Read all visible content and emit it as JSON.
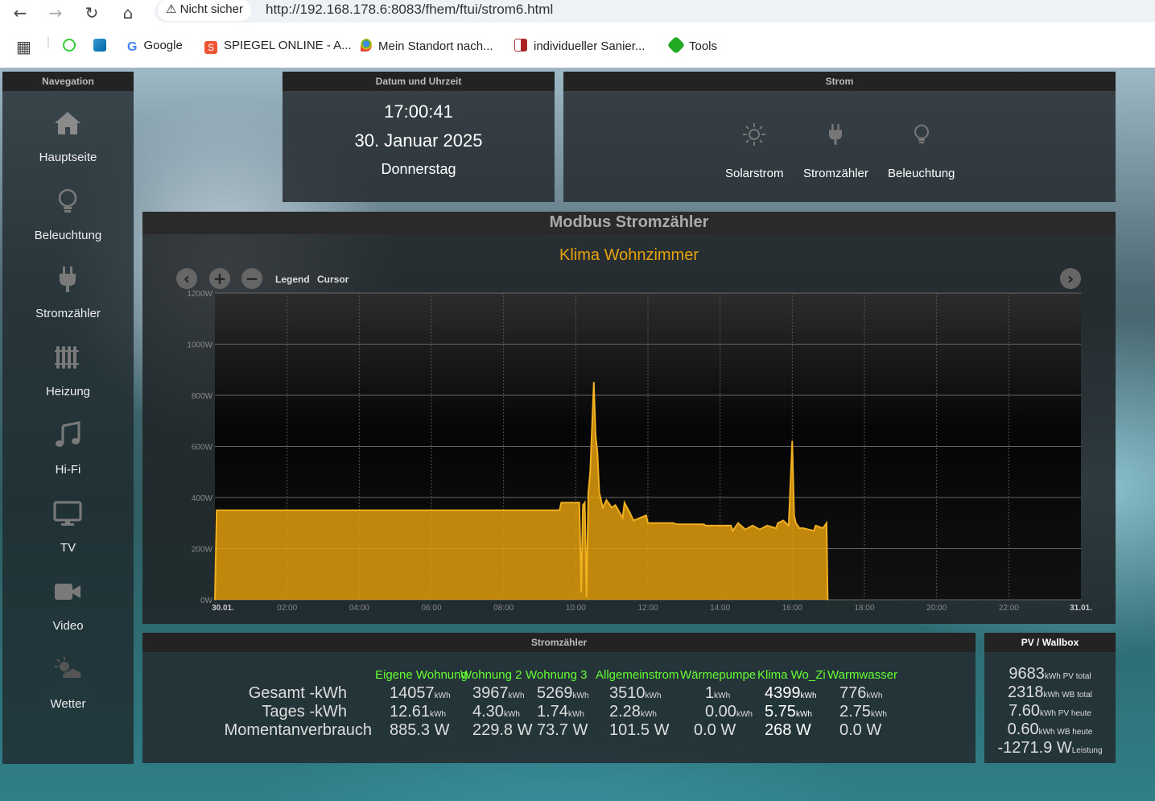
{
  "browser": {
    "security_label": "Nicht sicher",
    "url": "http://192.168.178.6:8083/fhem/ftui/strom6.html",
    "bookmarks": [
      "Google",
      "SPIEGEL ONLINE - A...",
      "Mein Standort nach...",
      "individueller Sanier...",
      "Tools"
    ]
  },
  "sidebar": {
    "title": "Navegation",
    "items": [
      {
        "label": "Hauptseite",
        "icon": "home-icon"
      },
      {
        "label": "Beleuchtung",
        "icon": "lightbulb-icon"
      },
      {
        "label": "Stromzähler",
        "icon": "plug-icon"
      },
      {
        "label": "Heizung",
        "icon": "radiator-icon"
      },
      {
        "label": "Hi-Fi",
        "icon": "music-icon"
      },
      {
        "label": "TV",
        "icon": "monitor-icon"
      },
      {
        "label": "Video",
        "icon": "video-camera-icon"
      },
      {
        "label": "Wetter",
        "icon": "weather-icon"
      }
    ]
  },
  "datetime": {
    "title": "Datum und Uhrzeit",
    "time": "17:00:41",
    "date": "30. Januar 2025",
    "weekday": "Donnerstag"
  },
  "strom": {
    "title": "Strom",
    "items": [
      {
        "label": "Solarstrom",
        "icon": "sun-icon"
      },
      {
        "label": "Stromzähler",
        "icon": "plug-icon"
      },
      {
        "label": "Beleuchtung",
        "icon": "lightbulb-icon"
      }
    ]
  },
  "chart": {
    "title": "Modbus Stromzähler",
    "subtitle": "Klima Wohnzimmer",
    "controls": {
      "legend": "Legend",
      "cursor": "Cursor"
    }
  },
  "chart_data": {
    "type": "area",
    "title": "Klima Wohnzimmer",
    "xlabel": "",
    "ylabel": "",
    "color": "#e8a20c",
    "ylim": [
      0,
      1200
    ],
    "yticks": [
      "0W",
      "200W",
      "400W",
      "600W",
      "800W",
      "1000W",
      "1200W"
    ],
    "xticks": [
      "30.01.",
      "02:00",
      "04:00",
      "06:00",
      "08:00",
      "10:00",
      "12:00",
      "14:00",
      "16:00",
      "18:00",
      "20:00",
      "22:00",
      "31.01."
    ],
    "xlim": [
      0,
      24
    ],
    "x": [
      0,
      0.05,
      9.55,
      9.6,
      10.1,
      10.15,
      10.2,
      10.25,
      10.3,
      10.35,
      10.4,
      10.5,
      10.55,
      10.6,
      10.65,
      10.75,
      10.85,
      11.0,
      11.1,
      11.3,
      11.35,
      11.5,
      11.6,
      11.95,
      12.0,
      12.7,
      12.8,
      13.55,
      13.6,
      14.3,
      14.35,
      14.5,
      14.7,
      14.9,
      15.1,
      15.3,
      15.55,
      15.6,
      15.75,
      15.9,
      16.0,
      16.05,
      16.1,
      16.2,
      16.3,
      16.6,
      16.65,
      16.85,
      16.95,
      16.98
    ],
    "y": [
      0,
      350,
      350,
      380,
      380,
      30,
      370,
      380,
      10,
      420,
      500,
      850,
      640,
      580,
      420,
      360,
      390,
      360,
      370,
      320,
      380,
      340,
      310,
      330,
      300,
      300,
      295,
      295,
      290,
      290,
      270,
      300,
      275,
      290,
      275,
      290,
      280,
      300,
      310,
      290,
      620,
      330,
      300,
      280,
      280,
      270,
      290,
      280,
      300,
      0
    ]
  },
  "meters": {
    "title": "Stromzähler",
    "headers": [
      "Eigene Wohnung",
      "Wohnung 2",
      "Wohnung 3",
      "Allgemeinstrom",
      "Wärmepumpe",
      "Klima Wo_Zi",
      "Warmwasser"
    ],
    "row_labels": [
      "Gesamt -kWh",
      "Tages -kWh",
      "Momentanverbrauch"
    ],
    "unit_kwh": "kWh",
    "gesamt": [
      "14057",
      "3967",
      "5269",
      "3510",
      "1",
      "4399",
      "776"
    ],
    "tages": [
      "12.61",
      "4.30",
      "1.74",
      "2.28",
      "0.00",
      "5.75",
      "2.75"
    ],
    "moment": [
      "885.3 W",
      "229.8 W",
      "73.7 W",
      "101.5 W",
      "0.0 W",
      "268 W",
      "0.0 W"
    ]
  },
  "pv": {
    "title": "PV / Wallbox",
    "rows": [
      {
        "value": "9683",
        "unit": "kWh PV total"
      },
      {
        "value": "2318",
        "unit": "kWh WB total"
      },
      {
        "value": "7.60",
        "unit": "kWh PV heute"
      },
      {
        "value": "0.60",
        "unit": "kWh WB heute"
      },
      {
        "value": "-1271.9 W",
        "unit": "Leistung"
      }
    ]
  }
}
